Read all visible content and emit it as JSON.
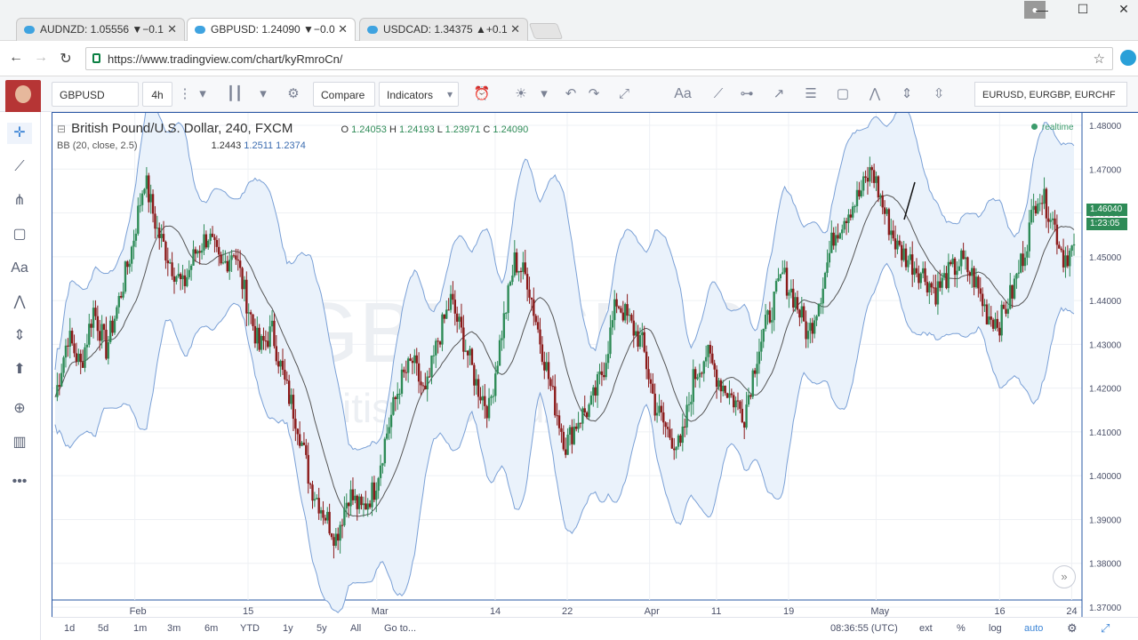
{
  "browser": {
    "tabs": [
      {
        "label": "AUDNZD: 1.05556 ▼−0.1",
        "active": false
      },
      {
        "label": "GBPUSD: 1.24090 ▼−0.0",
        "active": true
      },
      {
        "label": "USDCAD: 1.34375 ▲+0.1",
        "active": false
      }
    ],
    "url": "https://www.tradingview.com/chart/kyRmroCn/"
  },
  "toolbar": {
    "symbol": "GBPUSD",
    "interval": "4h",
    "compare_label": "Compare",
    "indicators_label": "Indicators",
    "font_tool": "Aa",
    "watchlist": "EURUSD, EURGBP, EURCHF"
  },
  "legend": {
    "title": "British Pound/U.S. Dollar, 240, FXCM",
    "ohlc": {
      "o_label": "O",
      "o": "1.24053",
      "h_label": "H",
      "h": "1.24193",
      "l_label": "L",
      "l": "1.23971",
      "c_label": "C",
      "c": "1.24090"
    },
    "indicator_name": "BB (20, close, 2.5)",
    "indicator_values": [
      "1.2443",
      "1.2511",
      "1.2374"
    ],
    "status": "realtime"
  },
  "watermark": {
    "symbol": "GBPUSD, 240",
    "name": "British Pound/U.S. Dollar"
  },
  "price_tags": [
    {
      "text": "1.46040",
      "color": "#2e8b57"
    },
    {
      "text": "1:23:05",
      "color": "#2e8b57"
    }
  ],
  "bottom": {
    "ranges": [
      "1d",
      "5d",
      "1m",
      "3m",
      "6m",
      "YTD",
      "1y",
      "5y",
      "All"
    ],
    "goto_label": "Go to...",
    "clock": "08:36:55 (UTC)",
    "options": [
      "ext",
      "%",
      "log",
      "auto"
    ]
  },
  "colors": {
    "up": "#2e8b57",
    "down": "#8b1a1a",
    "band": "#7aa0d6",
    "band_fill": "#eaf2fb",
    "basis": "#555555"
  },
  "chart_data": {
    "type": "candlestick",
    "ylim": [
      1.37,
      1.48
    ],
    "y_ticks": [
      "1.48000",
      "1.47000",
      "1.46000",
      "1.45000",
      "1.44000",
      "1.43000",
      "1.42000",
      "1.41000",
      "1.40000",
      "1.39000",
      "1.38000",
      "1.37000"
    ],
    "x_ticks": [
      "Feb",
      "15",
      "Mar",
      "14",
      "22",
      "Apr",
      "11",
      "19",
      "May",
      "16",
      "24"
    ],
    "series": [
      {
        "name": "Bollinger basis"
      },
      {
        "name": "Bollinger upper"
      },
      {
        "name": "Bollinger lower"
      }
    ],
    "close_path": [
      1.418,
      1.432,
      1.425,
      1.438,
      1.429,
      1.44,
      1.452,
      1.468,
      1.456,
      1.449,
      1.443,
      1.451,
      1.455,
      1.447,
      1.452,
      1.44,
      1.429,
      1.433,
      1.421,
      1.412,
      1.398,
      1.392,
      1.386,
      1.396,
      1.392,
      1.397,
      1.41,
      1.421,
      1.426,
      1.418,
      1.431,
      1.44,
      1.431,
      1.421,
      1.415,
      1.433,
      1.449,
      1.445,
      1.431,
      1.418,
      1.407,
      1.413,
      1.416,
      1.425,
      1.44,
      1.435,
      1.43,
      1.416,
      1.41,
      1.406,
      1.422,
      1.428,
      1.422,
      1.418,
      1.414,
      1.428,
      1.437,
      1.446,
      1.44,
      1.432,
      1.442,
      1.455,
      1.46,
      1.464,
      1.47,
      1.46,
      1.452,
      1.449,
      1.446,
      1.442,
      1.446,
      1.449,
      1.445,
      1.437,
      1.435,
      1.442,
      1.452,
      1.465,
      1.46,
      1.45,
      1.452
    ]
  }
}
